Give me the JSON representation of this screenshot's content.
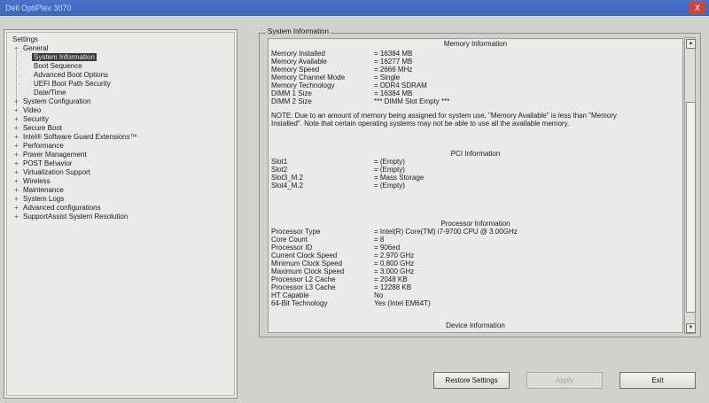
{
  "window": {
    "title": "Dell OptiPlex 3070",
    "close_label": "X"
  },
  "settings_tree": {
    "root_label": "Settings",
    "items": [
      {
        "label": "General",
        "expanded": true,
        "children": [
          {
            "label": "System Information",
            "selected": true
          },
          {
            "label": "Boot Sequence"
          },
          {
            "label": "Advanced Boot Options"
          },
          {
            "label": "UEFI Boot Path Security"
          },
          {
            "label": "Date/Time"
          }
        ]
      },
      {
        "label": "System Configuration"
      },
      {
        "label": "Video"
      },
      {
        "label": "Security"
      },
      {
        "label": "Secure Boot"
      },
      {
        "label": "Intel® Software Guard Extensions™"
      },
      {
        "label": "Performance"
      },
      {
        "label": "Power Management"
      },
      {
        "label": "POST Behavior"
      },
      {
        "label": "Virtualization Support"
      },
      {
        "label": "Wireless"
      },
      {
        "label": "Maintenance"
      },
      {
        "label": "System Logs"
      },
      {
        "label": "Advanced configurations"
      },
      {
        "label": "SupportAssist System Resolution"
      }
    ]
  },
  "panel": {
    "legend": "System Information",
    "memory": {
      "title": "Memory Information",
      "rows": [
        {
          "k": "Memory Installed",
          "v": "= 16384 MB"
        },
        {
          "k": "Memory Available",
          "v": "= 16277 MB"
        },
        {
          "k": "Memory Speed",
          "v": "= 2666 MHz"
        },
        {
          "k": "Memory Channel Mode",
          "v": "= Single"
        },
        {
          "k": "Memory Technology",
          "v": "= DDR4 SDRAM"
        },
        {
          "k": "DIMM 1 Size",
          "v": "= 16384 MB"
        },
        {
          "k": "DIMM 2 Size",
          "v": "*** DIMM Slot Empty ***"
        }
      ],
      "note": "NOTE: Due to an amount of memory being assigned for system use, \"Memory Available\" is less than \"Memory Installed\". Note that certain operating systems may not be able to use all the available memory."
    },
    "pci": {
      "title": "PCI Information",
      "rows": [
        {
          "k": "Slot1",
          "v": "= (Empty)"
        },
        {
          "k": "Slot2",
          "v": "= (Empty)"
        },
        {
          "k": "Slot3_M.2",
          "v": "= Mass Storage"
        },
        {
          "k": "Slot4_M.2",
          "v": "= (Empty)"
        }
      ]
    },
    "processor": {
      "title": "Processor Information",
      "rows": [
        {
          "k": "Processor Type",
          "v": "= Intel(R) Core(TM) i7-9700 CPU @ 3.00GHz"
        },
        {
          "k": "Core Count",
          "v": "= 8"
        },
        {
          "k": "Processor ID",
          "v": "= 906ed"
        },
        {
          "k": "Current Clock Speed",
          "v": "= 2.970 GHz"
        },
        {
          "k": "Minimum Clock Speed",
          "v": "= 0.800 GHz"
        },
        {
          "k": "Maximum Clock Speed",
          "v": "= 3.000 GHz"
        },
        {
          "k": "Processor L2 Cache",
          "v": "= 2048 KB"
        },
        {
          "k": "Processor L3 Cache",
          "v": "= 12288 KB"
        },
        {
          "k": "HT Capable",
          "v": "No"
        },
        {
          "k": "64-Bit Technology",
          "v": "Yes (Intel EM64T)"
        }
      ]
    },
    "device": {
      "title": "Device Information"
    }
  },
  "buttons": {
    "restore": "Restore Settings",
    "apply": "Apply",
    "exit": "Exit"
  }
}
